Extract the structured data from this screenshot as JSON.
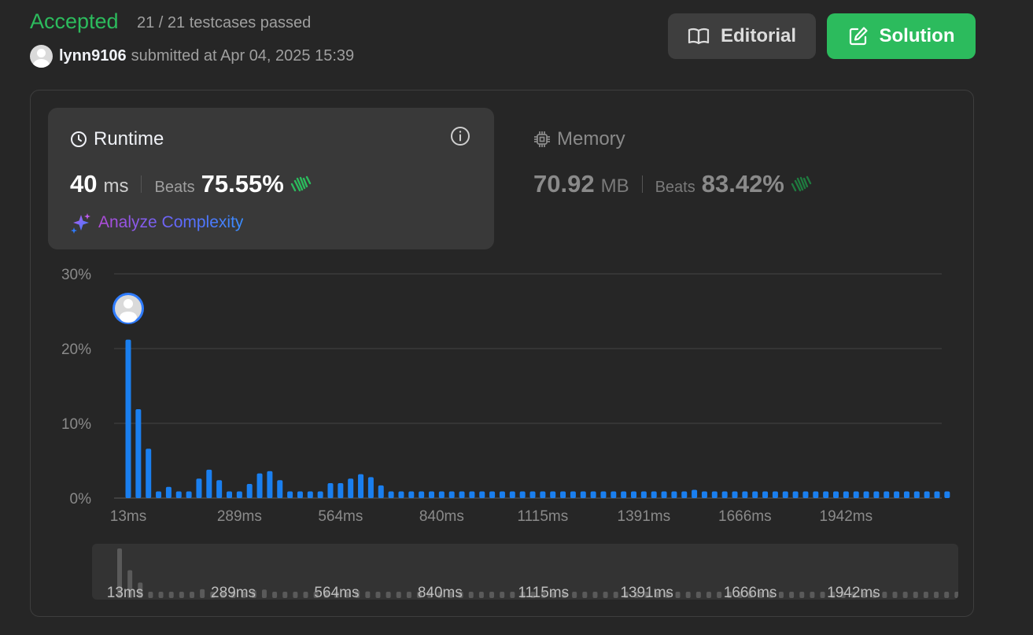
{
  "header": {
    "status": "Accepted",
    "testcases": "21 / 21 testcases passed",
    "username": "lynn9106",
    "submitted_text": "submitted at Apr 04, 2025 15:39"
  },
  "buttons": {
    "editorial_label": "Editorial",
    "solution_label": "Solution"
  },
  "runtime": {
    "title": "Runtime",
    "value": "40",
    "unit": "ms",
    "beats_label": "Beats",
    "beats_value": "75.55%",
    "analyze_label": "Analyze Complexity"
  },
  "memory": {
    "title": "Memory",
    "value": "70.92",
    "unit": "MB",
    "beats_label": "Beats",
    "beats_value": "83.42%"
  },
  "colors": {
    "accent_green": "#2cbb5d",
    "bar_blue": "#1a7fef",
    "mini_bar": "#5a5a5a"
  },
  "chart_data": {
    "type": "bar",
    "y_ticks": [
      "30%",
      "20%",
      "10%",
      "0%"
    ],
    "ylim": [
      0,
      30
    ],
    "x_tick_labels": [
      "13ms",
      "289ms",
      "564ms",
      "840ms",
      "1115ms",
      "1391ms",
      "1666ms",
      "1942ms"
    ],
    "x_tick_bar_indices": [
      0,
      11,
      21,
      31,
      41,
      51,
      61,
      71
    ],
    "user_bar_index": 0,
    "values": [
      21.2,
      11.9,
      6.6,
      0.9,
      1.5,
      0.9,
      0.9,
      2.6,
      3.8,
      2.4,
      0.9,
      0.9,
      1.9,
      3.3,
      3.6,
      2.4,
      0.9,
      0.9,
      0.9,
      0.9,
      2.0,
      2.0,
      2.6,
      3.2,
      2.8,
      1.7,
      0.9,
      0.9,
      0.9,
      0.9,
      0.9,
      0.9,
      0.9,
      0.9,
      0.9,
      0.9,
      0.9,
      0.9,
      0.9,
      0.9,
      0.9,
      0.9,
      0.9,
      0.9,
      0.9,
      0.9,
      0.9,
      0.9,
      0.9,
      0.9,
      0.9,
      0.9,
      0.9,
      0.9,
      0.9,
      0.9,
      1.1,
      0.9,
      0.9,
      0.9,
      0.9,
      0.9,
      0.9,
      0.9,
      0.9,
      0.9,
      0.9,
      0.9,
      0.9,
      0.9,
      0.9,
      0.9,
      0.9,
      0.9,
      0.9,
      0.9,
      0.9,
      0.9,
      0.9,
      0.9,
      0.9,
      0.9,
      0.9
    ]
  }
}
